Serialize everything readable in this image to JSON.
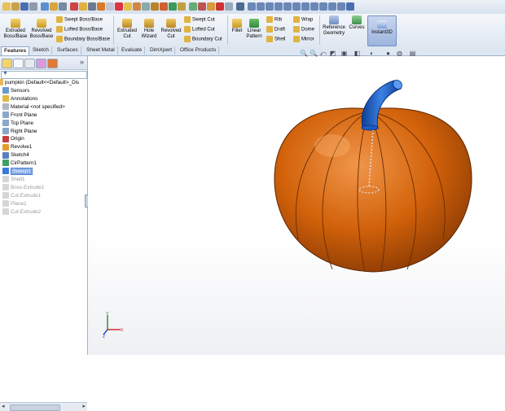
{
  "ribbon": {
    "extruded_boss": "Extruded\nBoss/Base",
    "revolved_boss": "Revolved\nBoss/Base",
    "swept_boss": "Swept Boss/Base",
    "lofted_boss": "Lofted Boss/Base",
    "boundary_boss": "Boundary Boss/Base",
    "extruded_cut": "Extruded\nCut",
    "hole_wizard": "Hole\nWizard",
    "revolved_cut": "Revolved\nCut",
    "swept_cut": "Swept Cut",
    "lofted_cut": "Lofted Cut",
    "boundary_cut": "Boundary Cut",
    "fillet": "Fillet",
    "linear_pattern": "Linear\nPattern",
    "rib": "Rib",
    "draft": "Draft",
    "shell": "Shell",
    "wrap": "Wrap",
    "dome": "Dome",
    "mirror": "Mirror",
    "reference_geometry": "Reference\nGeometry",
    "curves": "Curves",
    "instant3d": "Instant3D"
  },
  "tabs": [
    "Features",
    "Sketch",
    "Surfaces",
    "Sheet Metal",
    "Evaluate",
    "DimXpert",
    "Office Products"
  ],
  "tree": {
    "root": "pumpkin  (Default<<Default>_Dis",
    "items": [
      {
        "label": "Sensors",
        "icon": "sensor-icon",
        "state": "normal"
      },
      {
        "label": "Annotations",
        "icon": "annotation-icon",
        "state": "normal"
      },
      {
        "label": "Material <not specified>",
        "icon": "material-icon",
        "state": "normal"
      },
      {
        "label": "Front Plane",
        "icon": "plane-icon",
        "state": "normal"
      },
      {
        "label": "Top Plane",
        "icon": "plane-icon",
        "state": "normal"
      },
      {
        "label": "Right Plane",
        "icon": "plane-icon",
        "state": "normal"
      },
      {
        "label": "Origin",
        "icon": "origin-icon",
        "state": "normal"
      },
      {
        "label": "Revolve1",
        "icon": "revolve-icon",
        "state": "normal"
      },
      {
        "label": "Sketch4",
        "icon": "sketch-icon",
        "state": "normal"
      },
      {
        "label": "CirPattern1",
        "icon": "pattern-icon",
        "state": "normal"
      },
      {
        "label": "Sweep1",
        "icon": "sweep-icon",
        "state": "selected"
      },
      {
        "label": "Shell1",
        "icon": "shell-icon",
        "state": "suppressed"
      },
      {
        "label": "Boss-Extrude1",
        "icon": "extrude-icon",
        "state": "suppressed"
      },
      {
        "label": "Cut-Extrude1",
        "icon": "cut-icon",
        "state": "suppressed"
      },
      {
        "label": "Plane1",
        "icon": "plane-icon",
        "state": "suppressed"
      },
      {
        "label": "Cut-Extrude2",
        "icon": "cut-icon",
        "state": "suppressed"
      }
    ]
  },
  "colors": {
    "pumpkin_body": "#d2620a",
    "pumpkin_dark": "#7a3102",
    "stem_blue": "#1a5fc8",
    "selection_blue": "#7fa8e6"
  }
}
